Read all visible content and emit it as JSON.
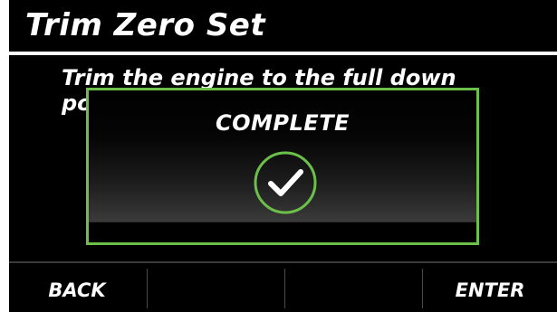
{
  "screen": {
    "title": "Trim Zero Set",
    "instruction": "Trim the engine to the full down position."
  },
  "modal": {
    "title": "COMPLETE",
    "icon": "checkmark-circle-icon"
  },
  "softkeys": [
    {
      "label": "BACK"
    },
    {
      "label": ""
    },
    {
      "label": ""
    },
    {
      "label": "ENTER"
    }
  ],
  "colors": {
    "background": "#000000",
    "text": "#ffffff",
    "accent": "#6cc04a"
  }
}
